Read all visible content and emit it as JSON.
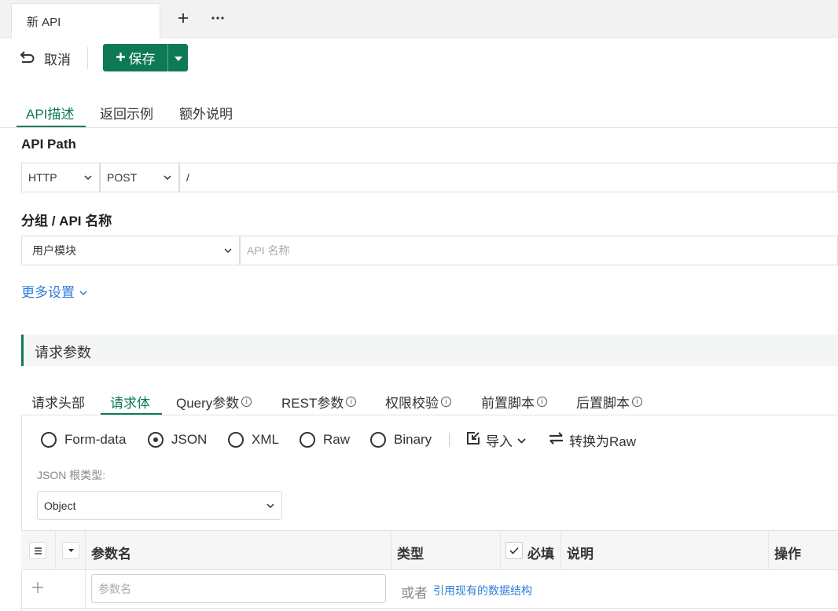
{
  "tabstrip": {
    "tab_title": "新 API",
    "add_icon": "plus-icon",
    "more_icon": "ellipsis-icon"
  },
  "toolbar": {
    "cancel_label": "取消",
    "save_label": "保存",
    "save_color": "#0e7a55"
  },
  "main_tabs": [
    {
      "label": "API描述",
      "active": true
    },
    {
      "label": "返回示例",
      "active": false
    },
    {
      "label": "额外说明",
      "active": false
    }
  ],
  "api_path": {
    "label": "API Path",
    "protocol": "HTTP",
    "method": "POST",
    "path_value": "/"
  },
  "group_name": {
    "label": "分组 / API 名称",
    "group_value": "用户模块",
    "name_placeholder": "API 名称"
  },
  "more_settings": "更多设置",
  "request": {
    "section_title": "请求参数",
    "tabs": [
      {
        "label": "请求头部",
        "info": false
      },
      {
        "label": "请求体",
        "info": false,
        "active": true
      },
      {
        "label": "Query参数",
        "info": true
      },
      {
        "label": "REST参数",
        "info": true
      },
      {
        "label": "权限校验",
        "info": true
      },
      {
        "label": "前置脚本",
        "info": true
      },
      {
        "label": "后置脚本",
        "info": true
      }
    ],
    "body_types": [
      {
        "label": "Form-data",
        "selected": false
      },
      {
        "label": "JSON",
        "selected": true
      },
      {
        "label": "XML",
        "selected": false
      },
      {
        "label": "Raw",
        "selected": false
      },
      {
        "label": "Binary",
        "selected": false
      }
    ],
    "import_label": "导入",
    "convert_label": "转换为Raw",
    "json_root_label": "JSON 根类型:",
    "json_root_value": "Object",
    "table": {
      "col_name": "参数名",
      "col_type": "类型",
      "col_required": "必填",
      "col_desc": "说明",
      "col_action": "操作"
    },
    "param_placeholder": "参数名",
    "or_text": "或者",
    "reference_link": "引用现有的数据结构"
  }
}
